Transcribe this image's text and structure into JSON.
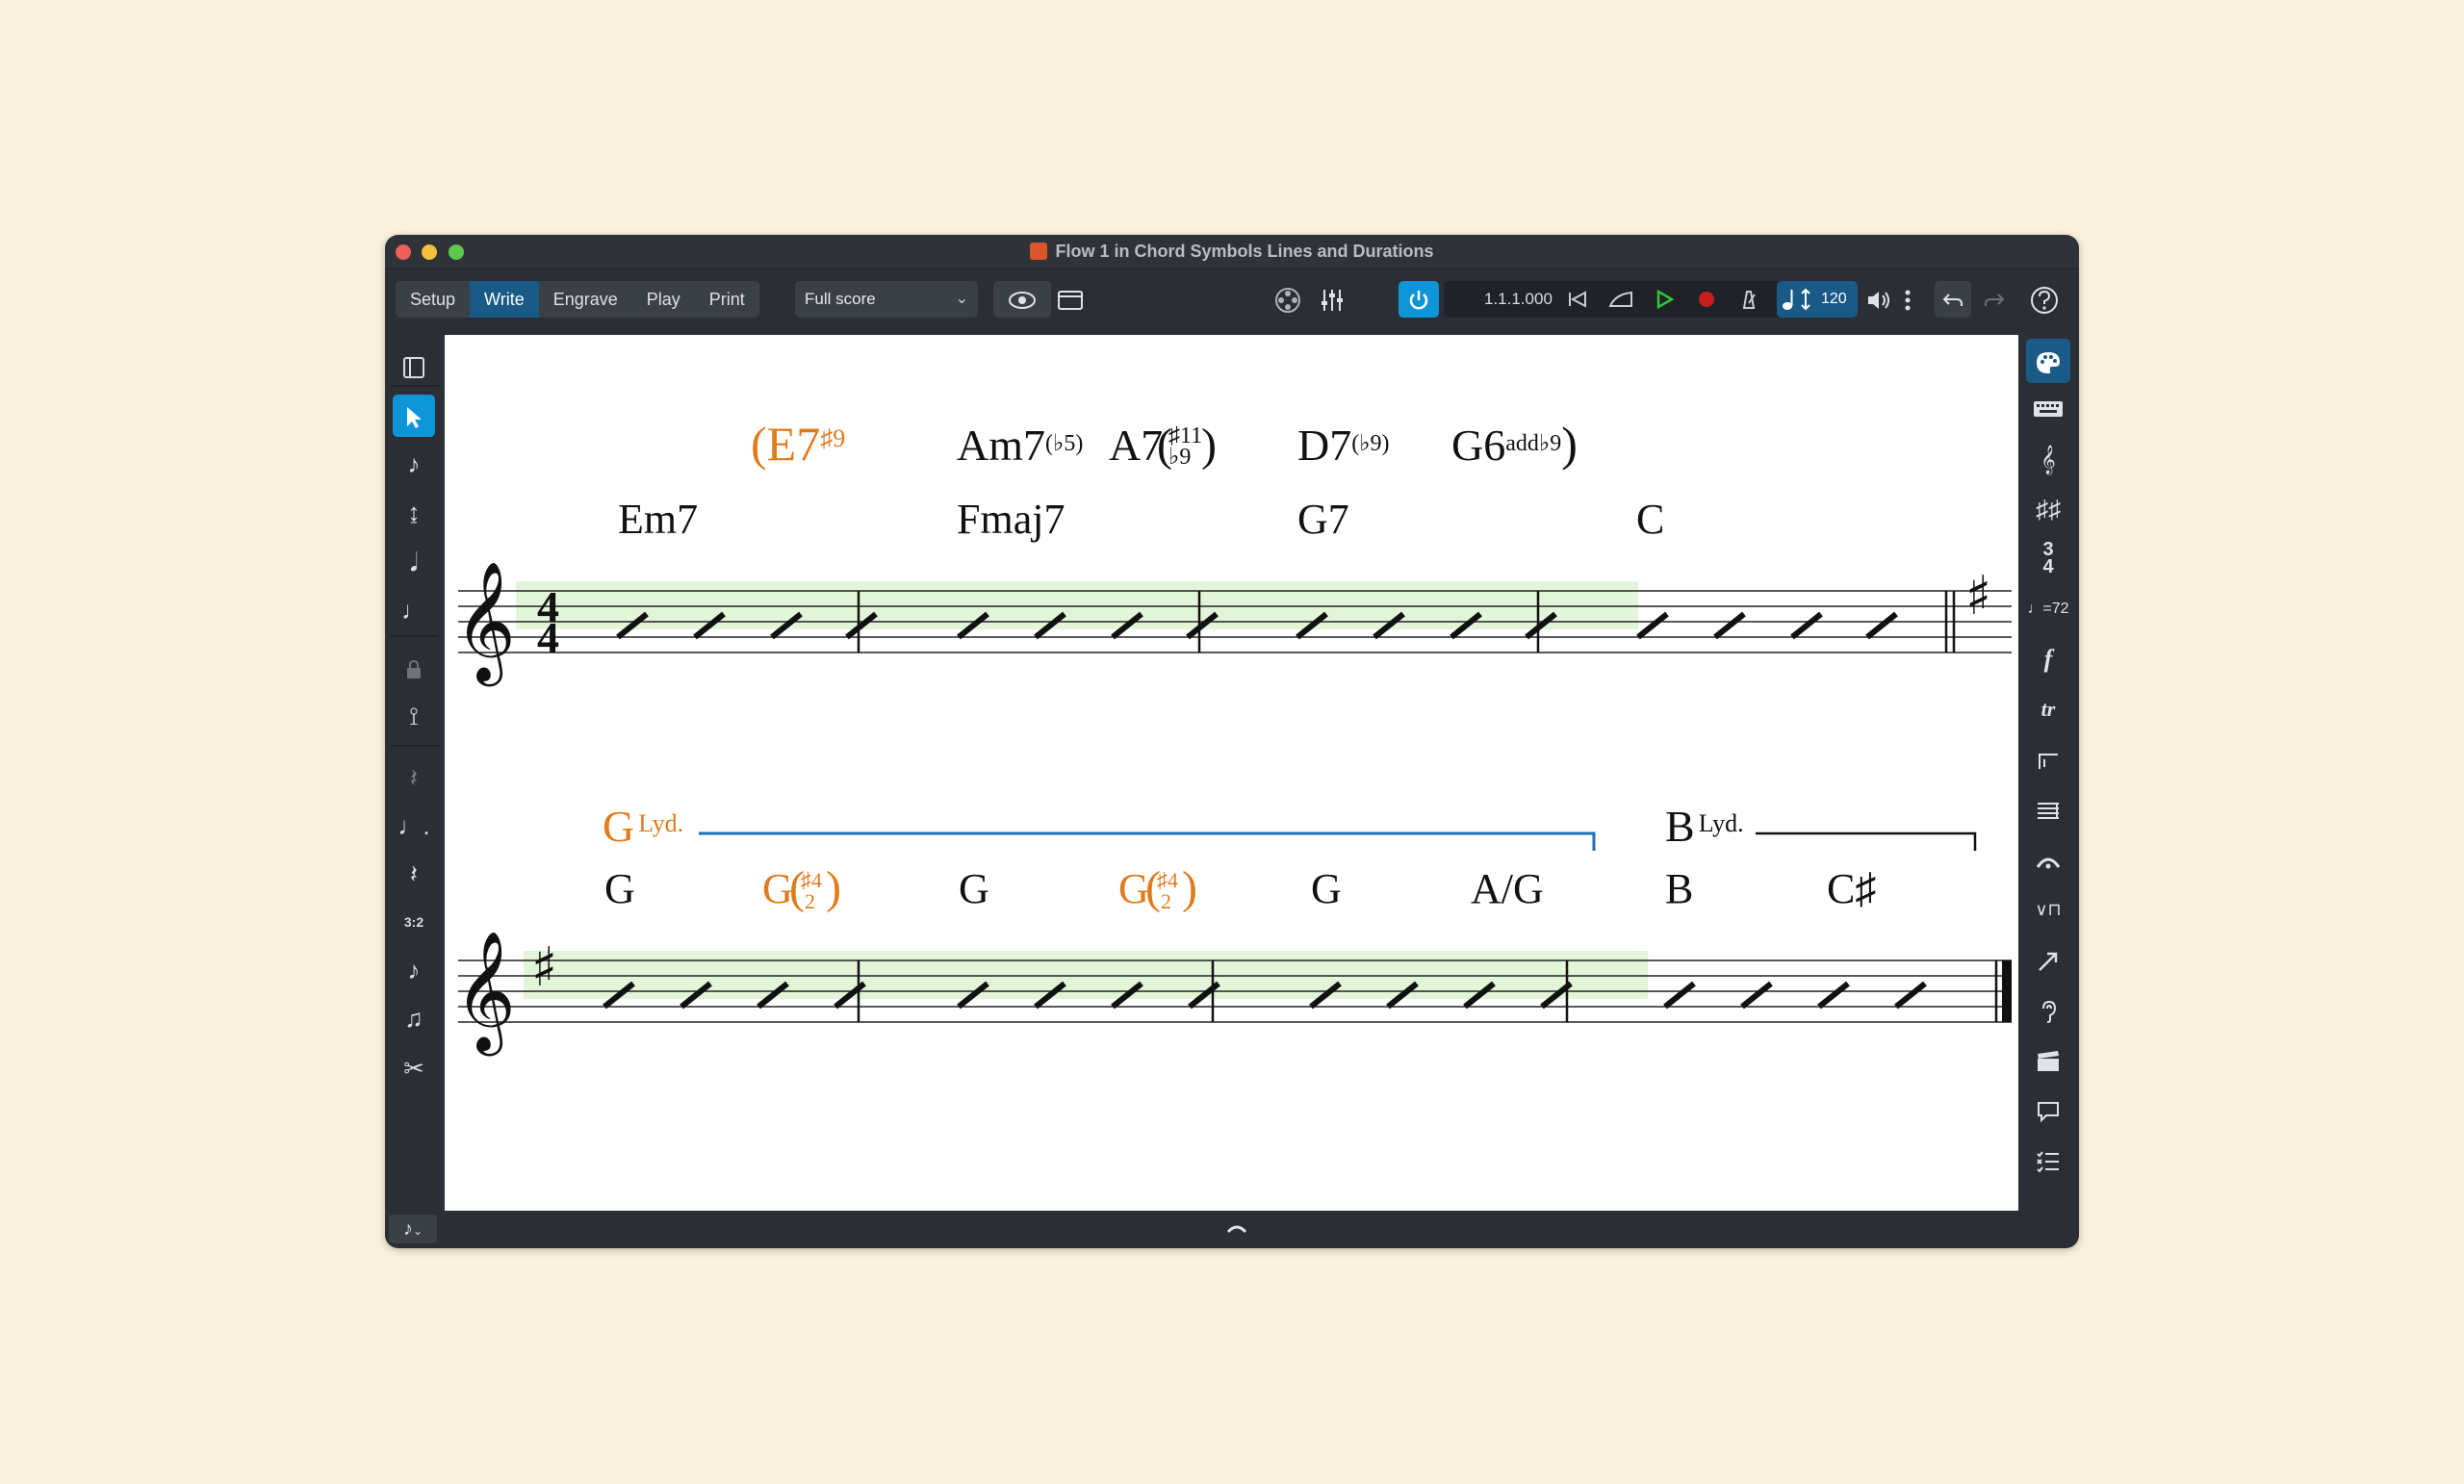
{
  "window": {
    "title": "Flow 1 in Chord Symbols Lines and Durations"
  },
  "toolbar": {
    "modes": [
      "Setup",
      "Write",
      "Engrave",
      "Play",
      "Print"
    ],
    "active_mode": "Write",
    "layout": "Full score",
    "transport_position": "1.1.1.000",
    "tempo": "120"
  },
  "colors": {
    "accent": "#0e95d8",
    "active_mode": "#1a5a86",
    "highlight_chord": "#e07b1c",
    "line_blue": "#1e6fb8",
    "note_input_region": "#e3f5d8"
  },
  "left_panel_icons": [
    "panel-toggle-icon",
    "select-arrow-icon",
    "insert-note-icon",
    "pitch-up-down-icon",
    "chord-icon",
    "tie-slur-icon",
    "lock-icon",
    "caret-icon",
    "rest-insert-icon",
    "dotted-note-icon",
    "rest-icon",
    "tuplet-icon",
    "grace-note-icon",
    "tie-icon",
    "scissors-icon"
  ],
  "left_panel_labels": {
    "tuplet": "3:2"
  },
  "right_panel_icons": [
    "palette-icon",
    "keyboard-icon",
    "clef-icon",
    "key-signature-icon",
    "time-signature-icon",
    "tempo-icon",
    "dynamics-icon",
    "ornaments-icon",
    "repeat-endings-icon",
    "bars-icon",
    "holds-pauses-icon",
    "playing-techniques-icon",
    "lines-icon",
    "lyrics-icon",
    "cues-icon",
    "comments-icon",
    "notations-list-icon"
  ],
  "right_panel_labels": {
    "tempo": "♩=72",
    "dynamics": "f",
    "ornaments": "tr"
  },
  "system1": {
    "lower_chords": [
      "Em7",
      "Fmaj7",
      "G7",
      "C"
    ],
    "upper_chords": [
      {
        "root": "(E7",
        "ext": "♯9",
        "highlight": true
      },
      {
        "root": "Am7",
        "ext": "(♭5)",
        "highlight": false
      },
      {
        "root": "A7",
        "ext_top": "♯11",
        "ext_bottom": "♭9",
        "highlight": false
      },
      {
        "root": "D7",
        "ext": "(♭9)",
        "highlight": false
      },
      {
        "root": "G6",
        "ext": "add♭9",
        "close": ")",
        "highlight": false
      }
    ]
  },
  "system2": {
    "lines": [
      {
        "root": "G",
        "ext": "Lyd.",
        "highlight": true
      },
      {
        "root": "B",
        "ext": "Lyd.",
        "highlight": false
      }
    ],
    "chords": [
      {
        "root": "G",
        "highlight": false
      },
      {
        "root": "G",
        "ext_top": "♯4",
        "ext_bottom": "2",
        "highlight": true
      },
      {
        "root": "G",
        "highlight": false
      },
      {
        "root": "G",
        "ext_top": "♯4",
        "ext_bottom": "2",
        "highlight": true
      },
      {
        "root": "G",
        "highlight": false
      },
      {
        "root": "A/G",
        "highlight": false
      },
      {
        "root": "B",
        "highlight": false
      },
      {
        "root": "C♯",
        "highlight": false
      }
    ]
  }
}
